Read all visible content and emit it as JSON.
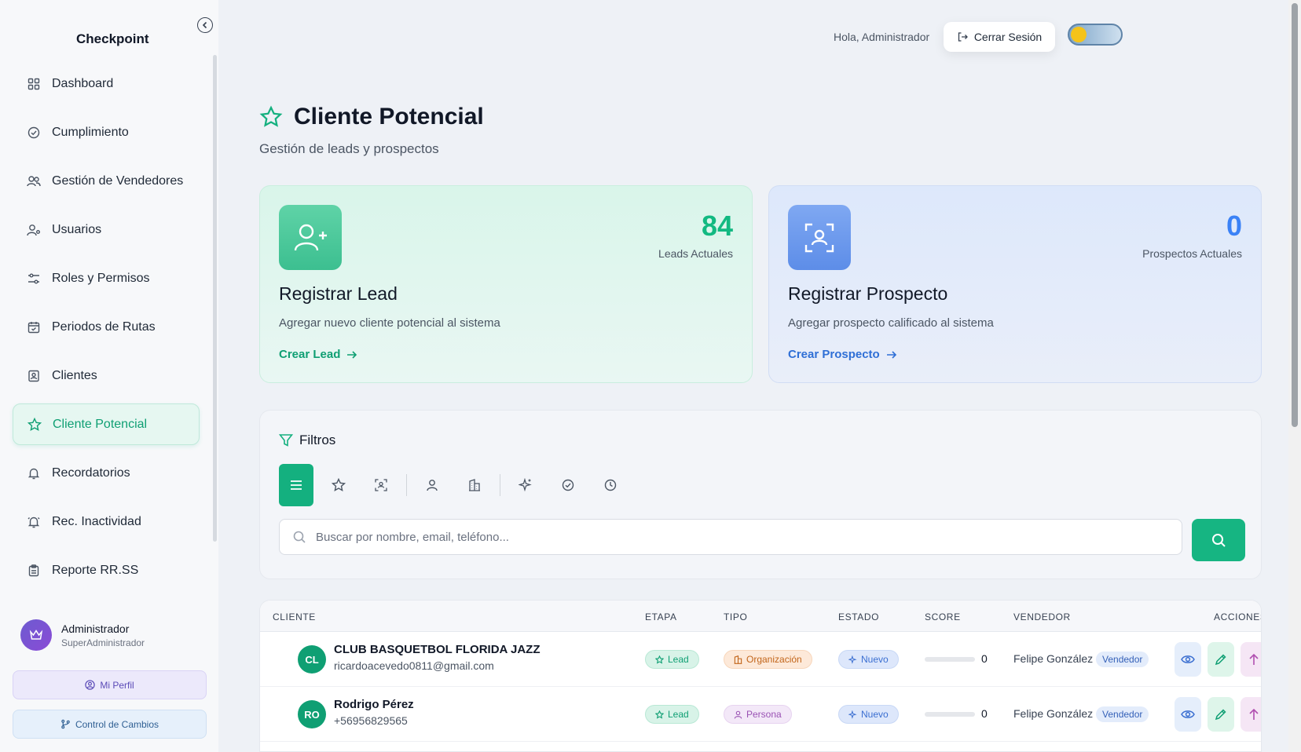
{
  "app": {
    "title": "Checkpoint"
  },
  "sidebar": {
    "items": [
      {
        "label": "Dashboard",
        "icon": "grid-icon"
      },
      {
        "label": "Cumplimiento",
        "icon": "check-circle-icon"
      },
      {
        "label": "Gestión de Vendedores",
        "icon": "users-icon"
      },
      {
        "label": "Usuarios",
        "icon": "user-gear-icon"
      },
      {
        "label": "Roles y Permisos",
        "icon": "sliders-icon"
      },
      {
        "label": "Periodos de Rutas",
        "icon": "calendar-icon"
      },
      {
        "label": "Clientes",
        "icon": "contact-card-icon"
      },
      {
        "label": "Cliente Potencial",
        "icon": "star-icon",
        "active": true
      },
      {
        "label": "Recordatorios",
        "icon": "bell-icon"
      },
      {
        "label": "Rec. Inactividad",
        "icon": "bell-ring-icon"
      },
      {
        "label": "Reporte RR.SS",
        "icon": "clipboard-icon"
      }
    ],
    "profile": {
      "name": "Administrador",
      "role": "SuperAdministrador"
    },
    "my_profile_label": "Mi Perfil",
    "changes_label": "Control de Cambios"
  },
  "header": {
    "greeting": "Hola, Administrador",
    "logout_label": "Cerrar Sesión"
  },
  "page": {
    "title": "Cliente Potencial",
    "subtitle": "Gestión de leads y prospectos"
  },
  "cards": {
    "lead": {
      "count": "84",
      "count_label": "Leads Actuales",
      "title": "Registrar Lead",
      "desc": "Agregar nuevo cliente potencial al sistema",
      "link": "Crear Lead"
    },
    "prospect": {
      "count": "0",
      "count_label": "Prospectos Actuales",
      "title": "Registrar Prospecto",
      "desc": "Agregar prospecto calificado al sistema",
      "link": "Crear Prospecto"
    }
  },
  "filters": {
    "title": "Filtros",
    "search_placeholder": "Buscar por nombre, email, teléfono..."
  },
  "table": {
    "headers": {
      "cliente": "CLIENTE",
      "etapa": "ETAPA",
      "tipo": "TIPO",
      "estado": "ESTADO",
      "score": "SCORE",
      "vendedor": "VENDEDOR",
      "acciones": "ACCIONES"
    },
    "rows": [
      {
        "initials": "CL",
        "name": "CLUB BASQUETBOL FLORIDA JAZZ",
        "contact": "ricardoacevedo0811@gmail.com",
        "etapa": "Lead",
        "tipo": "Organización",
        "estado": "Nuevo",
        "score": "0",
        "vendedor": "Felipe González",
        "vendedor_rol": "Vendedor"
      },
      {
        "initials": "RO",
        "name": "Rodrigo Pérez",
        "contact": "+56956829565",
        "etapa": "Lead",
        "tipo": "Persona",
        "estado": "Nuevo",
        "score": "0",
        "vendedor": "Felipe González",
        "vendedor_rol": "Vendedor"
      }
    ]
  },
  "colors": {
    "accent_green": "#14b07f",
    "accent_blue": "#3b82f6"
  }
}
